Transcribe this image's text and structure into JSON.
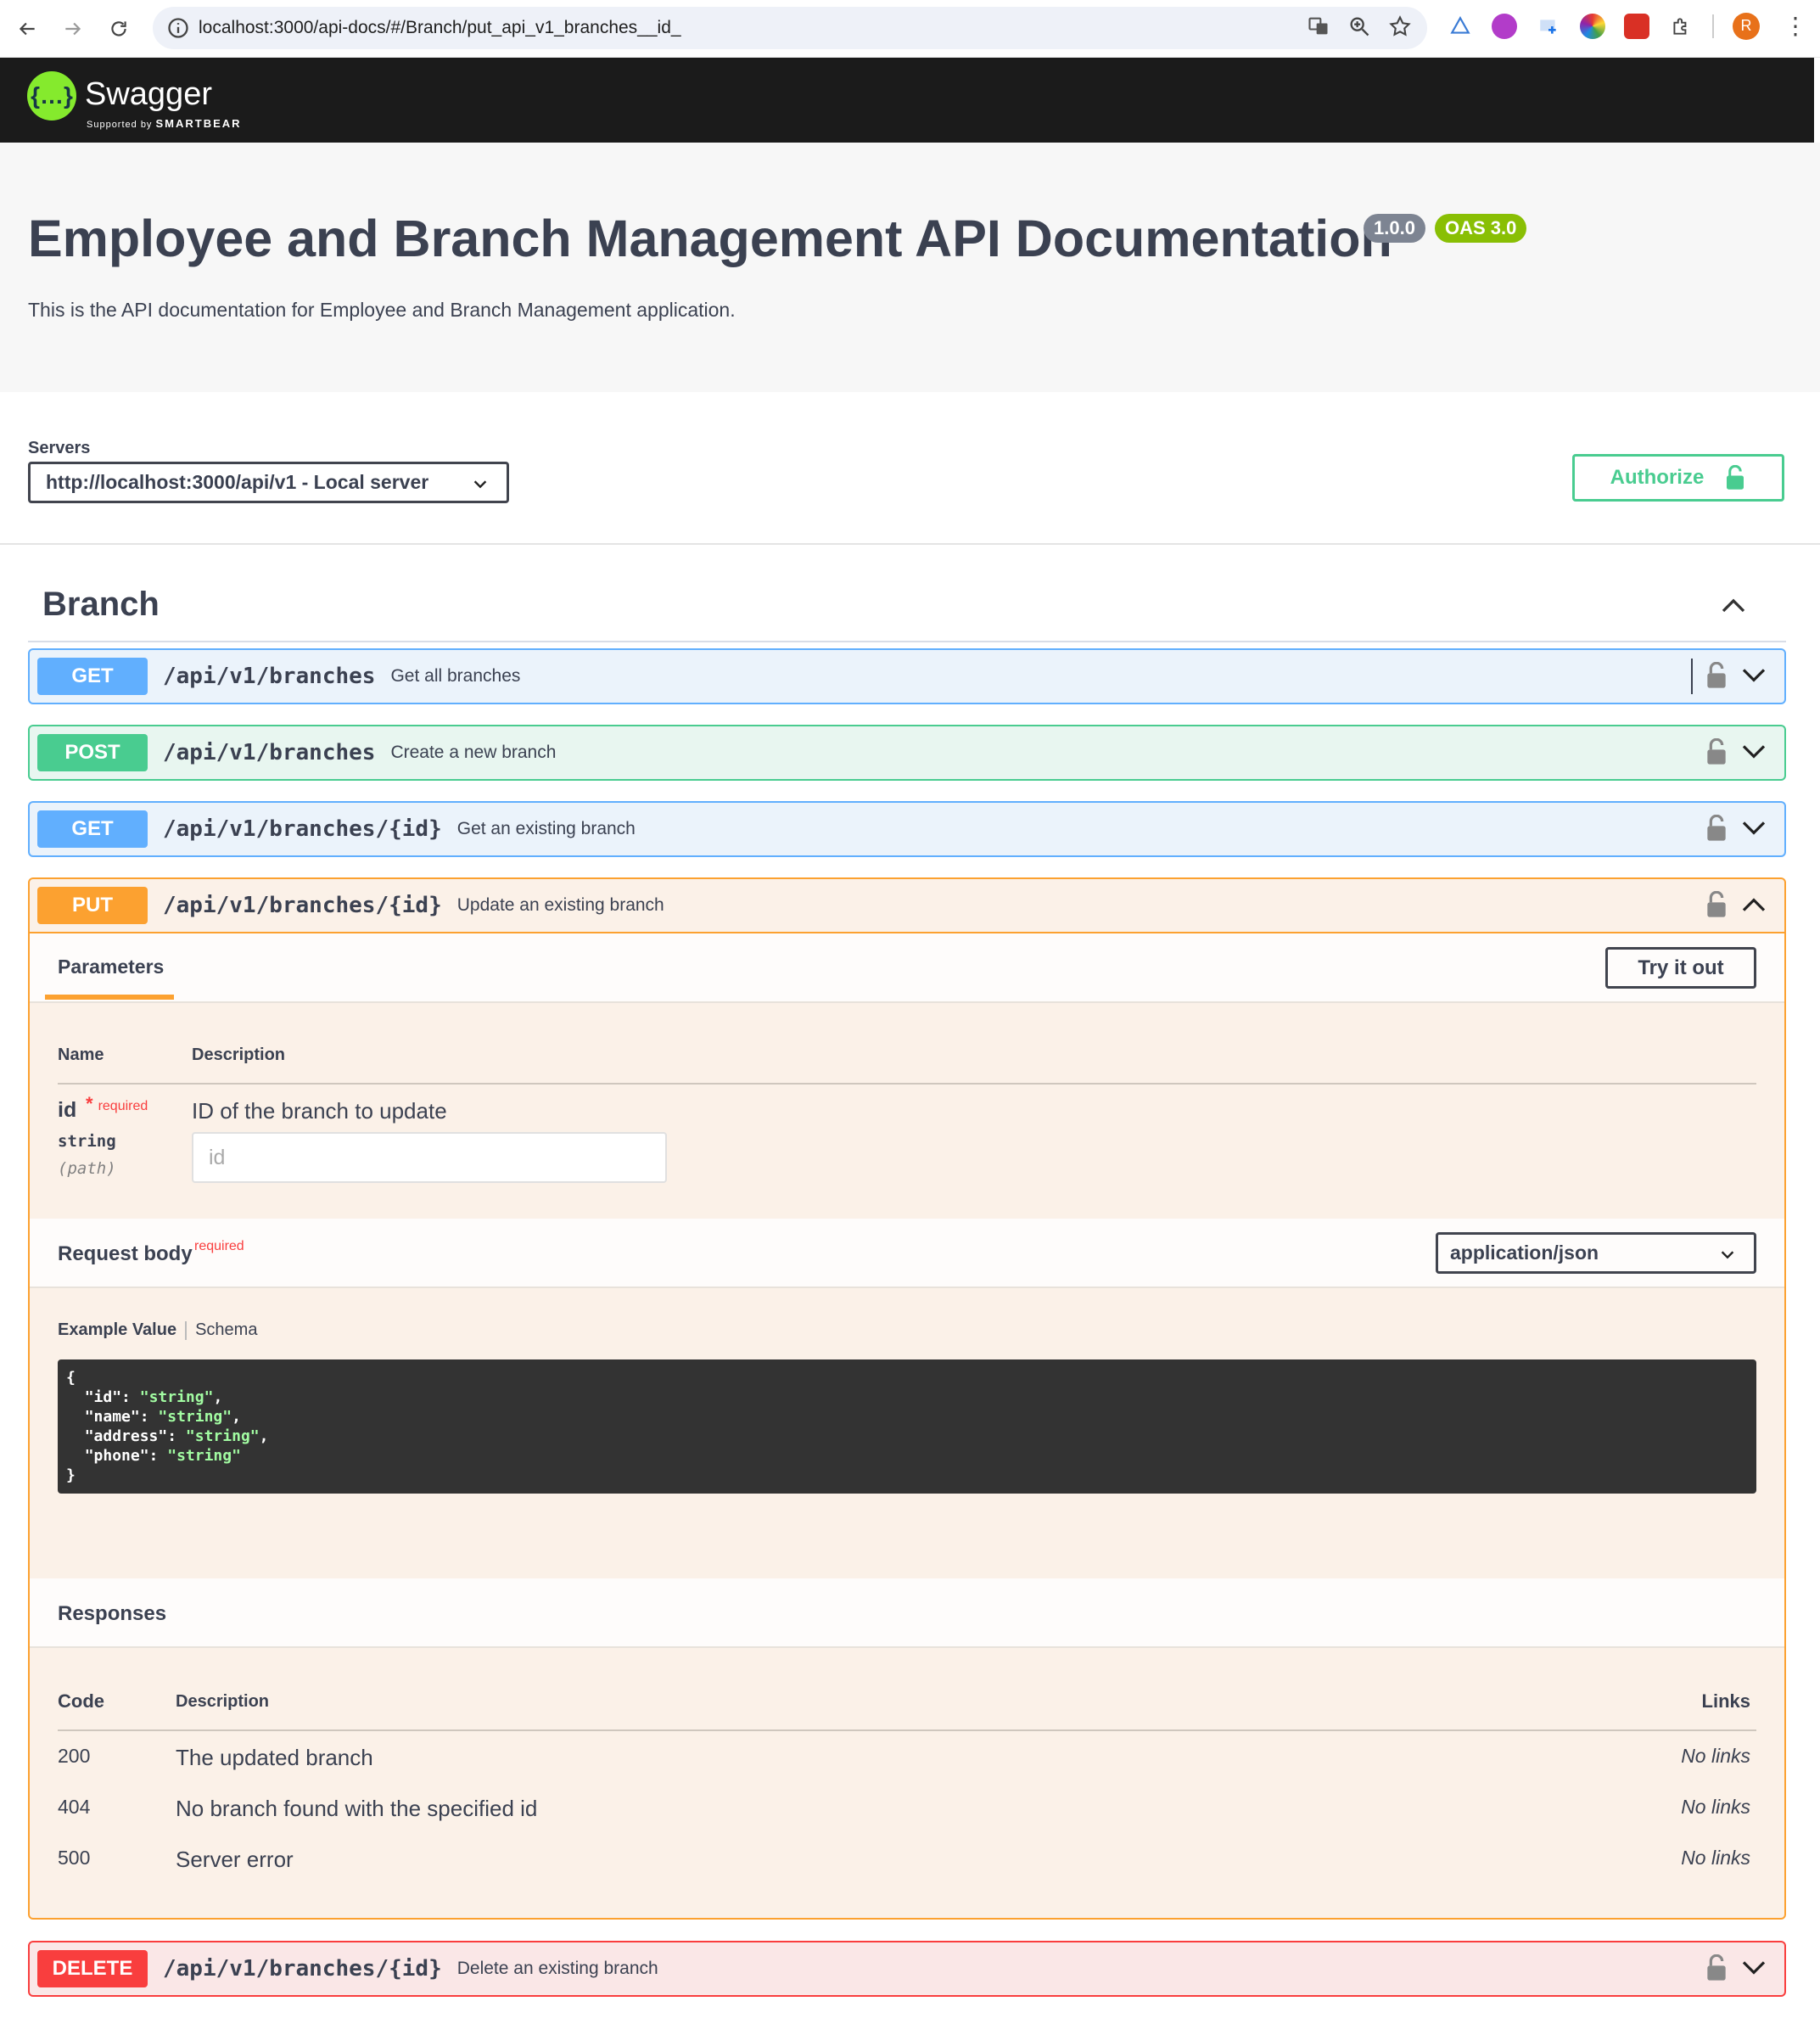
{
  "browser": {
    "url": "localhost:3000/api-docs/#/Branch/put_api_v1_branches__id_",
    "avatar_letter": "R"
  },
  "swagger": {
    "logo_text": "Swagger",
    "logo_sub": "Supported by",
    "logo_brand": "SMARTBEAR"
  },
  "info": {
    "title": "Employee and Branch Management API Documentation",
    "version": "1.0.0",
    "oas": "OAS 3.0",
    "description": "This is the API documentation for Employee and Branch Management application."
  },
  "servers": {
    "label": "Servers",
    "selected": "http://localhost:3000/api/v1 - Local server",
    "authorize_label": "Authorize"
  },
  "tag": {
    "name": "Branch"
  },
  "operations": [
    {
      "method": "GET",
      "path": "/api/v1/branches",
      "summary": "Get all branches"
    },
    {
      "method": "POST",
      "path": "/api/v1/branches",
      "summary": "Create a new branch"
    },
    {
      "method": "GET",
      "path": "/api/v1/branches/{id}",
      "summary": "Get an existing branch"
    },
    {
      "method": "PUT",
      "path": "/api/v1/branches/{id}",
      "summary": "Update an existing branch"
    },
    {
      "method": "DELETE",
      "path": "/api/v1/branches/{id}",
      "summary": "Delete an existing branch"
    }
  ],
  "put_details": {
    "parameters_tab": "Parameters",
    "try_it_out": "Try it out",
    "col_name": "Name",
    "col_description": "Description",
    "param": {
      "name": "id",
      "required_mark": "*",
      "required_label": "required",
      "type": "string",
      "in": "(path)",
      "description": "ID of the branch to update",
      "placeholder": "id"
    },
    "request_body_label": "Request body",
    "request_body_required": "required",
    "content_type": "application/json",
    "example_value_tab": "Example Value",
    "schema_tab": "Schema",
    "example_json": [
      {
        "key": "\"id\"",
        "value": "\"string\"",
        "comma": ","
      },
      {
        "key": "\"name\"",
        "value": "\"string\"",
        "comma": ","
      },
      {
        "key": "\"address\"",
        "value": "\"string\"",
        "comma": ","
      },
      {
        "key": "\"phone\"",
        "value": "\"string\"",
        "comma": ""
      }
    ],
    "responses_label": "Responses",
    "resp_col_code": "Code",
    "resp_col_description": "Description",
    "resp_col_links": "Links",
    "responses": [
      {
        "code": "200",
        "description": "The updated branch",
        "links": "No links"
      },
      {
        "code": "404",
        "description": "No branch found with the specified id",
        "links": "No links"
      },
      {
        "code": "500",
        "description": "Server error",
        "links": "No links"
      }
    ]
  },
  "colors": {
    "get": "#61affe",
    "post": "#49cc90",
    "put": "#fca130",
    "delete": "#f93e3e",
    "topbar": "#1b1b1b"
  }
}
